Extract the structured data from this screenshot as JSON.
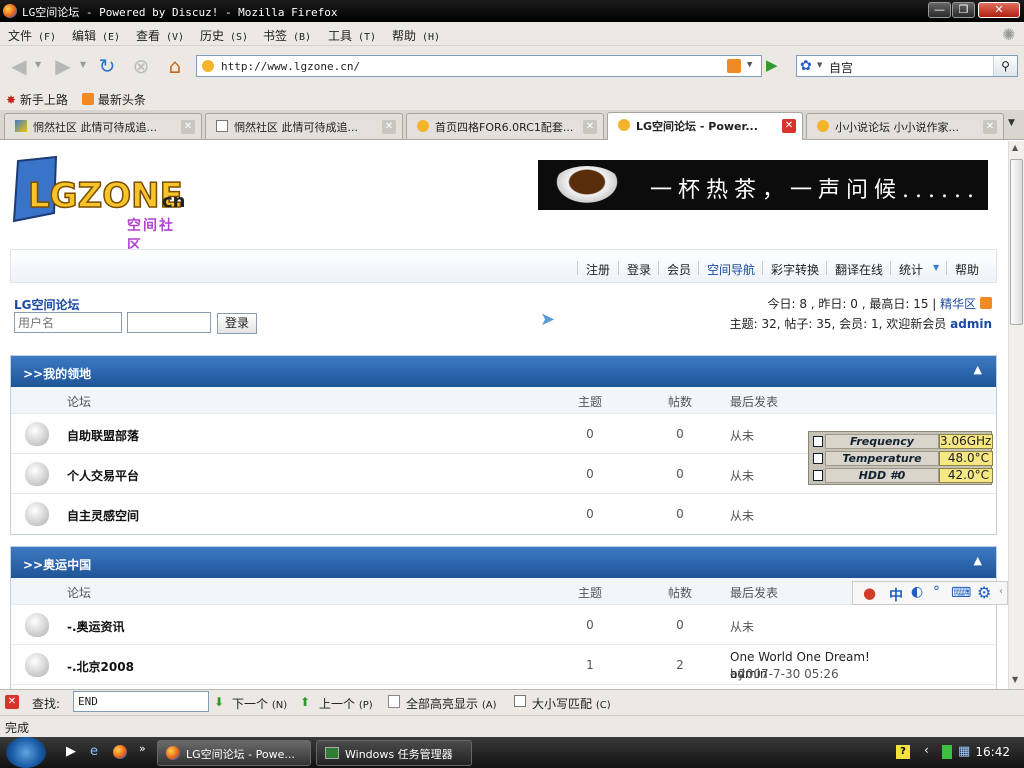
{
  "window": {
    "title": "LG空间论坛 - Powered by Discuz! - Mozilla Firefox",
    "controls": {
      "minimize": "—",
      "maximize": "❐",
      "close": "✕"
    }
  },
  "menu": [
    {
      "label": "文件",
      "key": "(F)"
    },
    {
      "label": "编辑",
      "key": "(E)"
    },
    {
      "label": "查看",
      "key": "(V)"
    },
    {
      "label": "历史",
      "key": "(S)"
    },
    {
      "label": "书签",
      "key": "(B)"
    },
    {
      "label": "工具",
      "key": "(T)"
    },
    {
      "label": "帮助",
      "key": "(H)"
    }
  ],
  "toolbar": {
    "url": "http://www.lgzone.cn/",
    "search_value": "自宫"
  },
  "bookmarks": [
    "新手上路",
    "最新头条"
  ],
  "tabs": [
    {
      "label": "惘然社区 此情可待成追...",
      "active": false
    },
    {
      "label": "惘然社区 此情可待成追...",
      "active": false
    },
    {
      "label": "首页四格FOR6.0RC1配套...",
      "active": false
    },
    {
      "label": "LG空间论坛 - Power...",
      "active": true
    },
    {
      "label": "小小说论坛 小小说作家...",
      "active": false
    }
  ],
  "page": {
    "logo_sub": "空间社区",
    "banner_text": "一杯热茶，一声问候......",
    "nav": [
      "注册",
      "登录",
      "会员",
      "空间导航",
      "彩字转换",
      "翻译在线",
      "统计",
      "帮助"
    ],
    "forum_title": "LG空间论坛",
    "login": {
      "username_placeholder": "用户名",
      "button": "登录"
    },
    "stats_line1": "今日: 8 , 昨日: 0 , 最高日: 15 |",
    "stats_digest": "精华区",
    "stats_line2": "主题: 32, 帖子: 35, 会员: 1, 欢迎新会员",
    "stats_newmember": "admin",
    "columns": {
      "forum": "论坛",
      "topics": "主题",
      "posts": "帖数",
      "last": "最后发表"
    },
    "sections": [
      {
        "title": ">>我的领地",
        "rows": [
          {
            "name": "自助联盟部落",
            "topics": "0",
            "posts": "0",
            "last": "从未"
          },
          {
            "name": "个人交易平台",
            "topics": "0",
            "posts": "0",
            "last": "从未"
          },
          {
            "name": "自主灵感空间",
            "topics": "0",
            "posts": "0",
            "last": "从未"
          }
        ]
      },
      {
        "title": ">>奥运中国",
        "rows": [
          {
            "name": "-.奥运资讯",
            "topics": "0",
            "posts": "0",
            "last": "从未"
          },
          {
            "name": "-.北京2008",
            "topics": "1",
            "posts": "2",
            "last": "One World One Dream!",
            "last_by": "by",
            "last_user": "admin",
            "last_time": "- 2007-7-30 05:26"
          }
        ]
      }
    ]
  },
  "cpu_widget": [
    {
      "label": "Frequency",
      "value": "3.06GHz"
    },
    {
      "label": "Temperature",
      "value": "48.0°C"
    },
    {
      "label": "HDD #0",
      "value": "42.0°C"
    }
  ],
  "ime": {
    "mode": "中"
  },
  "findbar": {
    "label": "查找:",
    "value": "END",
    "next": "下一个",
    "next_key": "(N)",
    "prev": "上一个",
    "prev_key": "(P)",
    "highlight": "全部高亮显示",
    "highlight_key": "(A)",
    "matchcase": "大小写匹配",
    "matchcase_key": "(C)"
  },
  "status": "完成",
  "taskbar": {
    "tasks": [
      "LG空间论坛 - Powe...",
      "Windows 任务管理器"
    ],
    "clock": "16:42"
  }
}
